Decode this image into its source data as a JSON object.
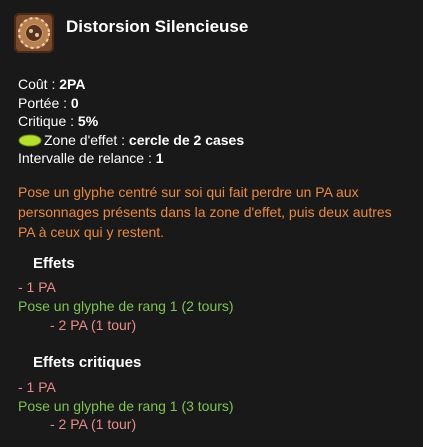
{
  "spell": {
    "icon": "spell-glyph-icon",
    "title": "Distorsion Silencieuse"
  },
  "stats": {
    "cost_label": "Coût :",
    "cost_value": "2PA",
    "range_label": "Portée :",
    "range_value": "0",
    "crit_label": "Critique :",
    "crit_value": "5%",
    "aoe_icon": "area-of-effect-icon",
    "aoe_label": "Zone d'effet :",
    "aoe_value": "cercle de 2 cases",
    "cooldown_label": "Intervalle de relance :",
    "cooldown_value": "1"
  },
  "description": "Pose un glyphe centré sur soi qui fait perdre un PA aux personnages présents dans la zone d'effet, puis deux autres PA à ceux qui y restent.",
  "effects": {
    "title": "Effets",
    "line1": "- 1 PA",
    "line2": "Pose un glyphe de rang 1 (2 tours)",
    "line3": "- 2 PA (1 tour)"
  },
  "critical_effects": {
    "title": "Effets critiques",
    "line1": "- 1 PA",
    "line2": "Pose un glyphe de rang 1 (3 tours)",
    "line3": "- 2 PA (1 tour)"
  },
  "colors": {
    "background": "#191919",
    "description": "#e98a3d",
    "ap_loss": "#e78b8b",
    "glyph": "#7dc34e",
    "aoe_icon": "#b7e02c"
  }
}
